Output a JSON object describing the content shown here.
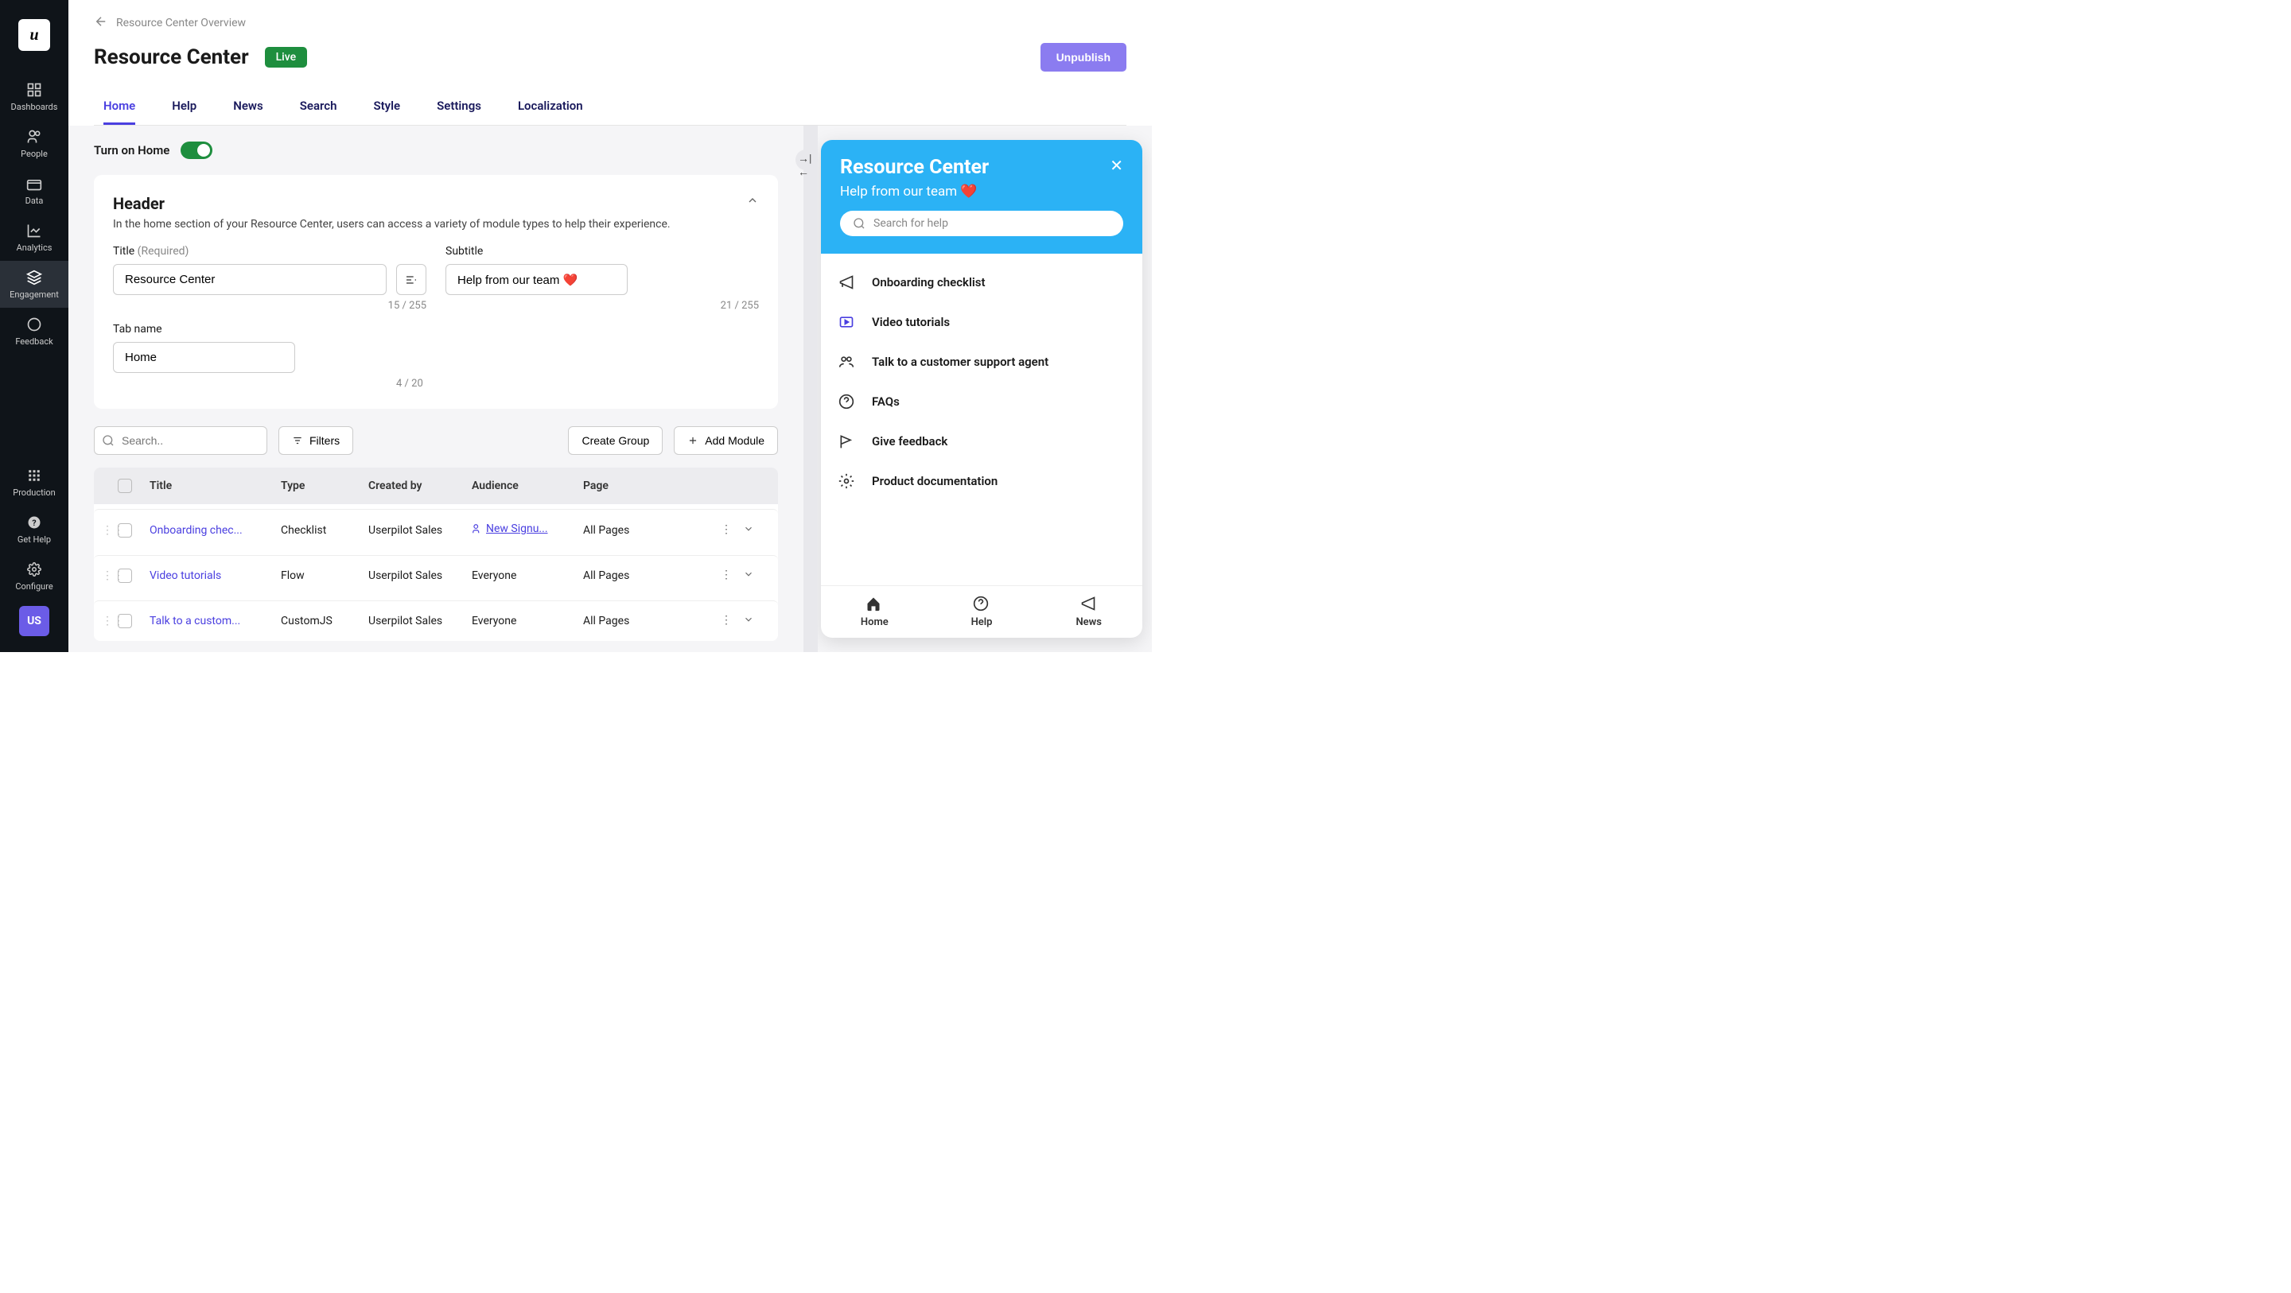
{
  "sidebar": {
    "logo_letter": "u",
    "items": [
      {
        "label": "Dashboards",
        "icon": "grid"
      },
      {
        "label": "People",
        "icon": "people"
      },
      {
        "label": "Data",
        "icon": "data"
      },
      {
        "label": "Analytics",
        "icon": "chart"
      },
      {
        "label": "Engagement",
        "icon": "layers",
        "active": true
      },
      {
        "label": "Feedback",
        "icon": "chat"
      }
    ],
    "bottom_items": [
      {
        "label": "Production",
        "icon": "apps"
      },
      {
        "label": "Get Help",
        "icon": "help"
      },
      {
        "label": "Configure",
        "icon": "gear"
      }
    ],
    "badge": "US"
  },
  "breadcrumb": "Resource Center Overview",
  "page_title": "Resource Center",
  "status": "Live",
  "unpublish_label": "Unpublish",
  "tabs": [
    "Home",
    "Help",
    "News",
    "Search",
    "Style",
    "Settings",
    "Localization"
  ],
  "active_tab": 0,
  "toggle_label": "Turn on Home",
  "header_card": {
    "title": "Header",
    "desc": "In the home section of your Resource Center, users can access a variety of module types to help their experience.",
    "labels": {
      "title": "Title",
      "required": "(Required)",
      "subtitle": "Subtitle",
      "tab_name": "Tab name"
    },
    "title_value": "Resource Center",
    "title_counter": "15 / 255",
    "subtitle_value": "Help from our team ❤️",
    "subtitle_counter": "21 / 255",
    "tab_value": "Home",
    "tab_counter": "4 / 20"
  },
  "actions": {
    "search_placeholder": "Search..",
    "filters_label": "Filters",
    "create_group_label": "Create Group",
    "add_module_label": "Add Module"
  },
  "table": {
    "headers": {
      "title": "Title",
      "type": "Type",
      "created": "Created by",
      "audience": "Audience",
      "page": "Page"
    },
    "rows": [
      {
        "title": "Onboarding chec...",
        "type": "Checklist",
        "created": "Userpilot Sales",
        "audience": "New Signu...",
        "audience_link": true,
        "page": "All Pages"
      },
      {
        "title": "Video tutorials",
        "type": "Flow",
        "created": "Userpilot Sales",
        "audience": "Everyone",
        "audience_link": false,
        "page": "All Pages"
      },
      {
        "title": "Talk to a custom...",
        "type": "CustomJS",
        "created": "Userpilot Sales",
        "audience": "Everyone",
        "audience_link": false,
        "page": "All Pages"
      }
    ]
  },
  "preview": {
    "title": "Resource Center",
    "subtitle": "Help from our team ❤️",
    "search_placeholder": "Search for help",
    "items": [
      {
        "label": "Onboarding checklist",
        "icon": "megaphone"
      },
      {
        "label": "Video tutorials",
        "icon": "video"
      },
      {
        "label": "Talk to a customer support agent",
        "icon": "support"
      },
      {
        "label": "FAQs",
        "icon": "help"
      },
      {
        "label": "Give feedback",
        "icon": "flag"
      },
      {
        "label": "Product documentation",
        "icon": "gear"
      }
    ],
    "nav": [
      {
        "label": "Home",
        "icon": "home"
      },
      {
        "label": "Help",
        "icon": "help"
      },
      {
        "label": "News",
        "icon": "news"
      }
    ]
  }
}
